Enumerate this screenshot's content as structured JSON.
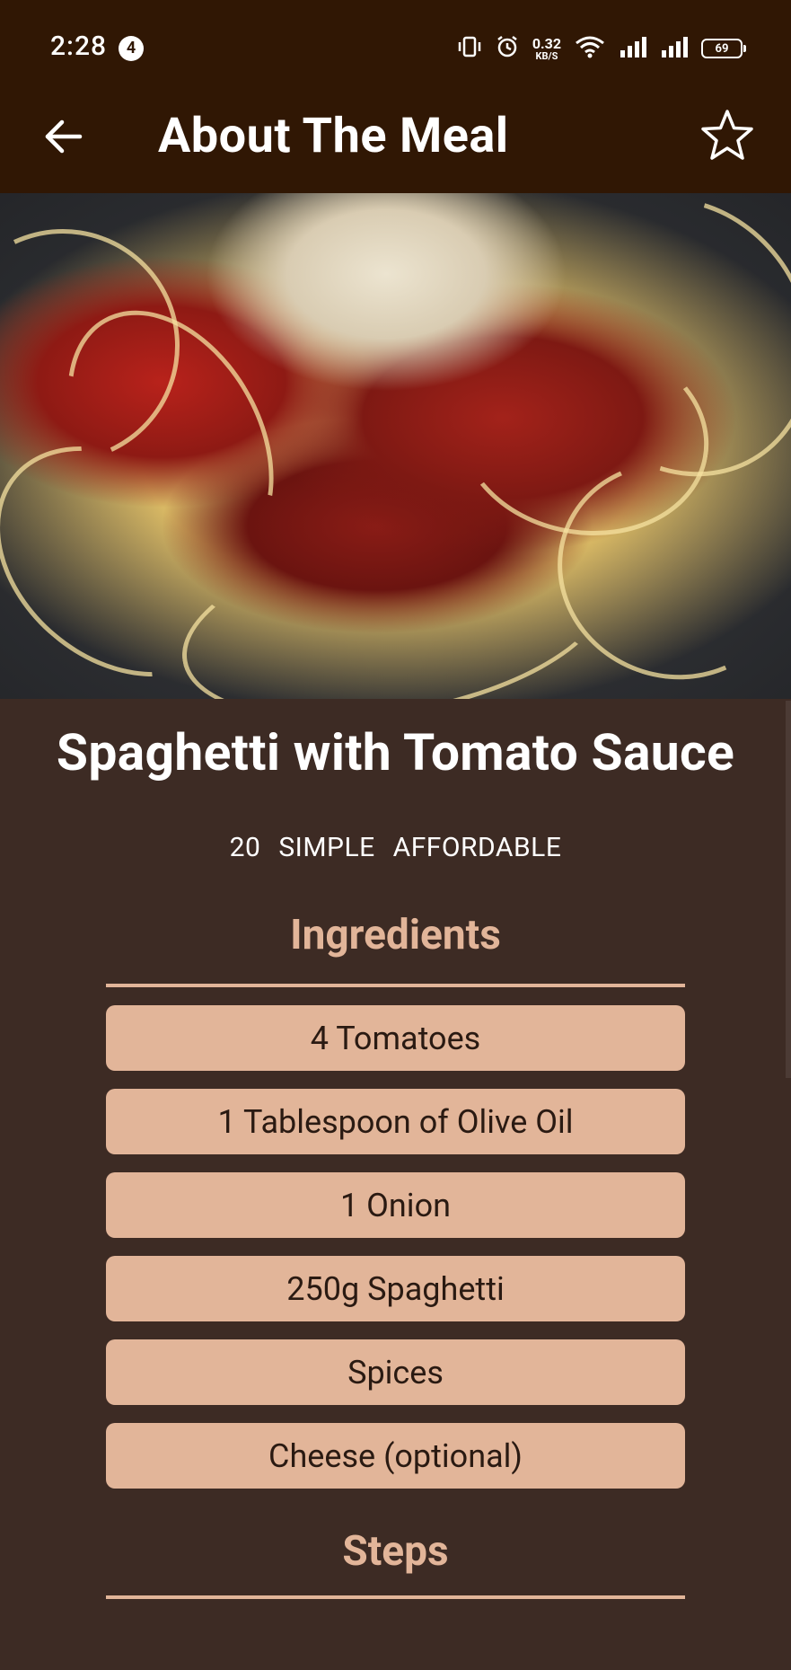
{
  "status_bar": {
    "time": "2:28",
    "notification_count": "4",
    "net_speed_value": "0.32",
    "net_speed_unit": "KB/S",
    "battery": "69",
    "icons": [
      "vibrate-icon",
      "alarm-icon",
      "wifi-icon",
      "signal-icon",
      "signal-icon",
      "battery-icon"
    ]
  },
  "toolbar": {
    "title": "About The Meal",
    "back_icon": "arrow-left-icon",
    "favorite_icon": "star-outline-icon"
  },
  "meal": {
    "image_description_name": "meal-image",
    "title": "Spaghetti with Tomato Sauce",
    "duration": "20",
    "complexity": "SIMPLE",
    "affordability": "AFFORDABLE"
  },
  "ingredients_section": {
    "title": "Ingredients",
    "items": [
      "4 Tomatoes",
      "1 Tablespoon of Olive Oil",
      "1 Onion",
      "250g Spaghetti",
      "Spices",
      "Cheese (optional)"
    ]
  },
  "steps_section": {
    "title": "Steps"
  },
  "colors": {
    "header": "#301704",
    "background": "#3d2b24",
    "accent": "#e2b599",
    "text": "#ffffff"
  }
}
